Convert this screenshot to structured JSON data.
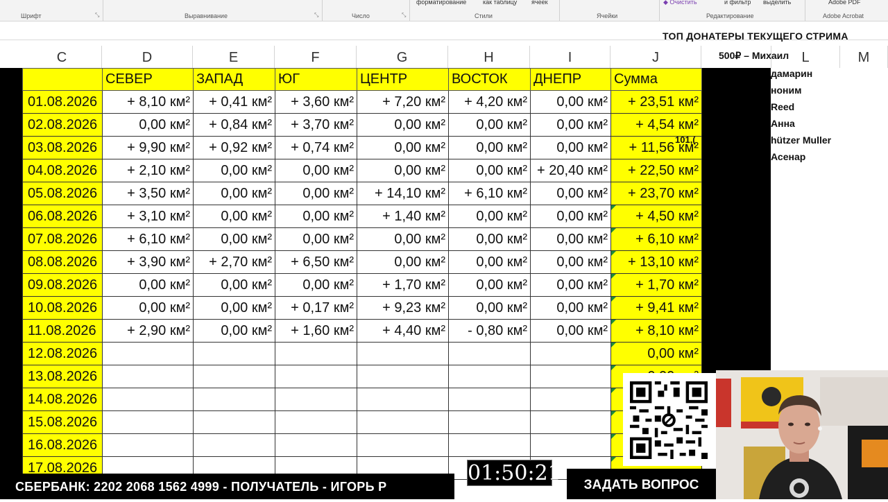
{
  "ribbon": {
    "groups": [
      {
        "label": "Шрифт"
      },
      {
        "label": "Выравнивание"
      },
      {
        "label": "Число"
      },
      {
        "label": "Стили",
        "items": [
          "форматирование",
          "как таблицу",
          "ячеек"
        ]
      },
      {
        "label": "Ячейки"
      },
      {
        "label": "Редактирование",
        "items": [
          "Очистить",
          "и фильтр",
          "выделить"
        ]
      },
      {
        "label": "Adobe Acrobat",
        "items": [
          "Adobe PDF"
        ]
      }
    ]
  },
  "column_headers": [
    "C",
    "D",
    "E",
    "F",
    "G",
    "H",
    "I",
    "J",
    "L",
    "M"
  ],
  "table": {
    "headers": [
      "СЕВЕР",
      "ЗАПАД",
      "ЮГ",
      "ЦЕНТР",
      "ВОСТОК",
      "ДНЕПР",
      "Сумма"
    ],
    "rows": [
      {
        "date": "01.08.2026",
        "values": [
          "+ 8,10 км²",
          "+ 0,41 км²",
          "+ 3,60 км²",
          "+ 7,20 км²",
          "+ 4,20 км²",
          "0,00 км²"
        ],
        "sum": "+ 23,51 км²"
      },
      {
        "date": "02.08.2026",
        "values": [
          "0,00 км²",
          "+ 0,84 км²",
          "+ 3,70 км²",
          "0,00 км²",
          "0,00 км²",
          "0,00 км²"
        ],
        "sum": "+ 4,54 км²"
      },
      {
        "date": "03.08.2026",
        "values": [
          "+ 9,90 км²",
          "+ 0,92 км²",
          "+ 0,74 км²",
          "0,00 км²",
          "0,00 км²",
          "0,00 км²"
        ],
        "sum": "+ 11,56 км²"
      },
      {
        "date": "04.08.2026",
        "values": [
          "+ 2,10 км²",
          "0,00 км²",
          "0,00 км²",
          "0,00 км²",
          "0,00 км²",
          "+ 20,40 км²"
        ],
        "sum": "+ 22,50 км²"
      },
      {
        "date": "05.08.2026",
        "values": [
          "+ 3,50 км²",
          "0,00 км²",
          "0,00 км²",
          "+ 14,10 км²",
          "+ 6,10 км²",
          "0,00 км²"
        ],
        "sum": "+ 23,70 км²"
      },
      {
        "date": "06.08.2026",
        "values": [
          "+ 3,10 км²",
          "0,00 км²",
          "0,00 км²",
          "+ 1,40 км²",
          "0,00 км²",
          "0,00 км²"
        ],
        "sum": "+ 4,50 км²"
      },
      {
        "date": "07.08.2026",
        "values": [
          "+ 6,10 км²",
          "0,00 км²",
          "0,00 км²",
          "0,00 км²",
          "0,00 км²",
          "0,00 км²"
        ],
        "sum": "+ 6,10 км²"
      },
      {
        "date": "08.08.2026",
        "values": [
          "+ 3,90 км²",
          "+ 2,70 км²",
          "+ 6,50 км²",
          "0,00 км²",
          "0,00 км²",
          "0,00 км²"
        ],
        "sum": "+ 13,10 км²"
      },
      {
        "date": "09.08.2026",
        "values": [
          "0,00 км²",
          "0,00 км²",
          "0,00 км²",
          "+ 1,70 км²",
          "0,00 км²",
          "0,00 км²"
        ],
        "sum": "+ 1,70 км²"
      },
      {
        "date": "10.08.2026",
        "values": [
          "0,00 км²",
          "0,00 км²",
          "+ 0,17 км²",
          "+ 9,23 км²",
          "0,00 км²",
          "0,00 км²"
        ],
        "sum": "+ 9,41 км²"
      },
      {
        "date": "11.08.2026",
        "values": [
          "+ 2,90 км²",
          "0,00 км²",
          "+ 1,60 км²",
          "+ 4,40 км²",
          "- 0,80 км²",
          "0,00 км²"
        ],
        "sum": "+ 8,10 км²"
      },
      {
        "date": "12.08.2026",
        "values": [
          "",
          "",
          "",
          "",
          "",
          ""
        ],
        "sum": "0,00 км²"
      },
      {
        "date": "13.08.2026",
        "values": [
          "",
          "",
          "",
          "",
          "",
          ""
        ],
        "sum": "0,00 км²"
      },
      {
        "date": "14.08.2026",
        "values": [
          "",
          "",
          "",
          "",
          "",
          ""
        ],
        "sum": ""
      },
      {
        "date": "15.08.2026",
        "values": [
          "",
          "",
          "",
          "",
          "",
          ""
        ],
        "sum": ""
      },
      {
        "date": "16.08.2026",
        "values": [
          "",
          "",
          "",
          "",
          "",
          ""
        ],
        "sum": ""
      },
      {
        "date": "17.08.2026",
        "values": [
          "",
          "",
          "",
          "",
          "",
          ""
        ],
        "sum": ""
      }
    ]
  },
  "donors": {
    "title": "ТОП ДОНАТЕРЫ ТЕКУЩЕГО СТРИМА",
    "top": "500₽ – Михаил",
    "partial": [
      "дамарин",
      "ноним",
      "Reed",
      "Анна",
      "hützer Muller",
      "Асенар"
    ],
    "fragment": "101,("
  },
  "overlay": {
    "bank": "СБЕРБАНК: 2202 2068 1562 4999 - ПОЛУЧАТЕЛЬ - ИГОРЬ Р",
    "timer": "01:50:21",
    "ask": "ЗАДАТЬ ВОПРОС"
  }
}
